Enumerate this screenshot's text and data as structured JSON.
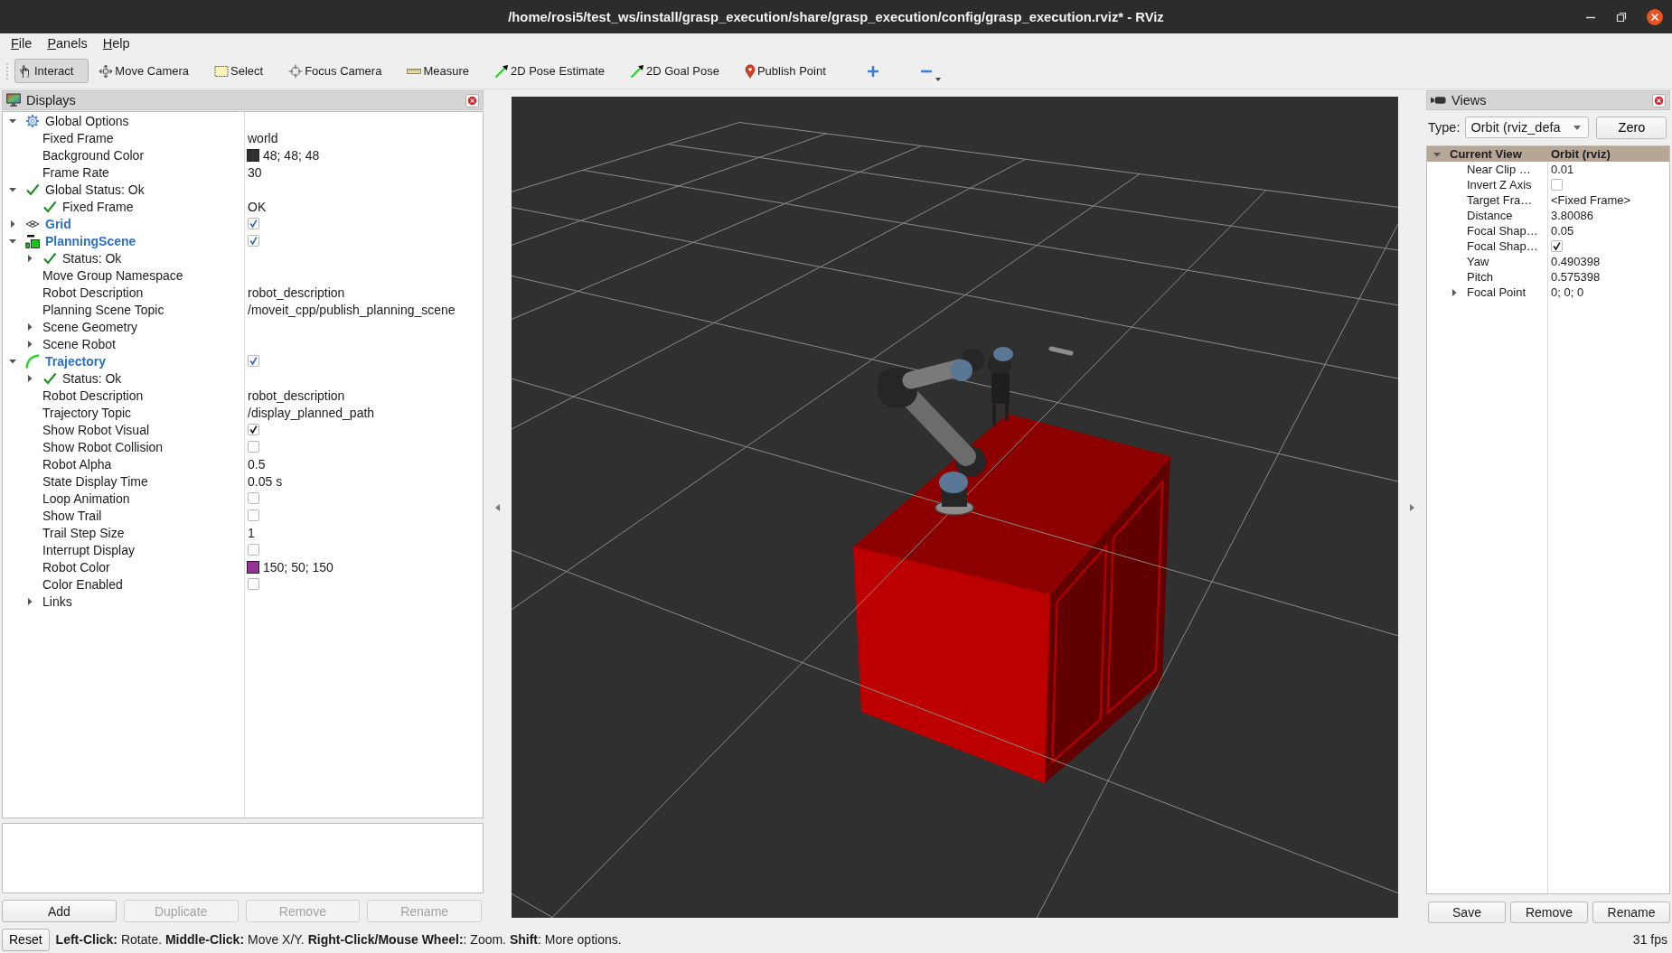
{
  "window": {
    "title": "/home/rosi5/test_ws/install/grasp_execution/share/grasp_execution/config/grasp_execution.rviz* - RViz"
  },
  "menu": [
    "File",
    "Panels",
    "Help"
  ],
  "toolbar": {
    "tools": [
      {
        "label": "Interact",
        "kind": "interact",
        "selected": true
      },
      {
        "label": "Move Camera",
        "kind": "move",
        "selected": false
      },
      {
        "label": "Select",
        "kind": "select",
        "selected": false
      },
      {
        "label": "Focus Camera",
        "kind": "focus",
        "selected": false
      },
      {
        "label": "Measure",
        "kind": "measure",
        "selected": false
      },
      {
        "label": "2D Pose Estimate",
        "kind": "pose",
        "selected": false
      },
      {
        "label": "2D Goal Pose",
        "kind": "goal",
        "selected": false
      },
      {
        "label": "Publish Point",
        "kind": "point",
        "selected": false
      }
    ],
    "actions": [
      {
        "kind": "add"
      },
      {
        "kind": "remove"
      }
    ]
  },
  "displays_panel": {
    "title": "Displays",
    "tree": [
      {
        "label": "Global Options",
        "kind": "global",
        "expanded": true,
        "children": [
          {
            "label": "Fixed Frame",
            "kind": "property",
            "value": "world"
          },
          {
            "label": "Background Color",
            "kind": "property",
            "color": "#303030",
            "value": "48; 48; 48"
          },
          {
            "label": "Frame Rate",
            "kind": "property",
            "value": "30"
          }
        ]
      },
      {
        "label": "Global Status: Ok",
        "kind": "status",
        "expanded": true,
        "children": [
          {
            "label": "Fixed Frame",
            "kind": "status",
            "value": "OK"
          }
        ]
      },
      {
        "label": "Grid",
        "kind": "grid",
        "expanded": false,
        "checked": true
      },
      {
        "label": "PlanningScene",
        "kind": "scene",
        "expanded": true,
        "checked": true,
        "children": [
          {
            "label": "Status: Ok",
            "kind": "status",
            "expanded": false
          },
          {
            "label": "Move Group Namespace",
            "kind": "property"
          },
          {
            "label": "Robot Description",
            "kind": "property",
            "value": "robot_description"
          },
          {
            "label": "Planning Scene Topic",
            "kind": "property",
            "value": "/moveit_cpp/publish_planning_scene"
          },
          {
            "label": "Scene Geometry",
            "kind": "property",
            "expanded": false
          },
          {
            "label": "Scene Robot",
            "kind": "property",
            "expanded": false
          }
        ]
      },
      {
        "label": "Trajectory",
        "kind": "trajectory",
        "expanded": true,
        "checked": true,
        "children": [
          {
            "label": "Status: Ok",
            "kind": "status",
            "expanded": false
          },
          {
            "label": "Robot Description",
            "kind": "property",
            "value": "robot_description"
          },
          {
            "label": "Trajectory Topic",
            "kind": "property",
            "value": "/display_planned_path"
          },
          {
            "label": "Show Robot Visual",
            "kind": "property",
            "checked": true
          },
          {
            "label": "Show Robot Collision",
            "kind": "property",
            "checked": false
          },
          {
            "label": "Robot Alpha",
            "kind": "property",
            "value": "0.5"
          },
          {
            "label": "State Display Time",
            "kind": "property",
            "value": "0.05 s"
          },
          {
            "label": "Loop Animation",
            "kind": "property",
            "checked": false
          },
          {
            "label": "Show Trail",
            "kind": "property",
            "checked": false
          },
          {
            "label": "Trail Step Size",
            "kind": "property",
            "value": "1"
          },
          {
            "label": "Interrupt Display",
            "kind": "property",
            "checked": false
          },
          {
            "label": "Robot Color",
            "kind": "property",
            "color": "#963296",
            "value": "150; 50; 150"
          },
          {
            "label": "Color Enabled",
            "kind": "property",
            "checked": false
          },
          {
            "label": "Links",
            "kind": "property",
            "expanded": false
          }
        ]
      }
    ],
    "buttons": [
      {
        "label": "Add",
        "disabled": false
      },
      {
        "label": "Duplicate",
        "disabled": true
      },
      {
        "label": "Remove",
        "disabled": true
      },
      {
        "label": "Rename",
        "disabled": true
      }
    ]
  },
  "views_panel": {
    "title": "Views",
    "type_label": "Type:",
    "type_value": "Orbit (rviz_defa",
    "zero_button": "Zero",
    "tree": [
      {
        "label": "Current View",
        "kind": "category",
        "value": "Orbit (rviz)",
        "expanded": true,
        "children": [
          {
            "label": "Near Clip …",
            "value": "0.01"
          },
          {
            "label": "Invert Z Axis",
            "checked": false
          },
          {
            "label": "Target Fra…",
            "value": "<Fixed Frame>"
          },
          {
            "label": "Distance",
            "value": "3.80086"
          },
          {
            "label": "Focal Shap…",
            "value": "0.05"
          },
          {
            "label": "Focal Shap…",
            "checked": true
          },
          {
            "label": "Yaw",
            "value": "0.490398"
          },
          {
            "label": "Pitch",
            "value": "0.575398"
          },
          {
            "label": "Focal Point",
            "expanded": false,
            "value": "0; 0; 0"
          }
        ]
      }
    ],
    "buttons": [
      "Save",
      "Remove",
      "Rename"
    ]
  },
  "status_bar": {
    "reset_button": "Reset",
    "hint": "**Left-Click:** Rotate. **Middle-Click:** Move X/Y. **Right-Click/Mouse Wheel:**: Zoom. **Shift**: More options.",
    "fps": "31 fps"
  }
}
